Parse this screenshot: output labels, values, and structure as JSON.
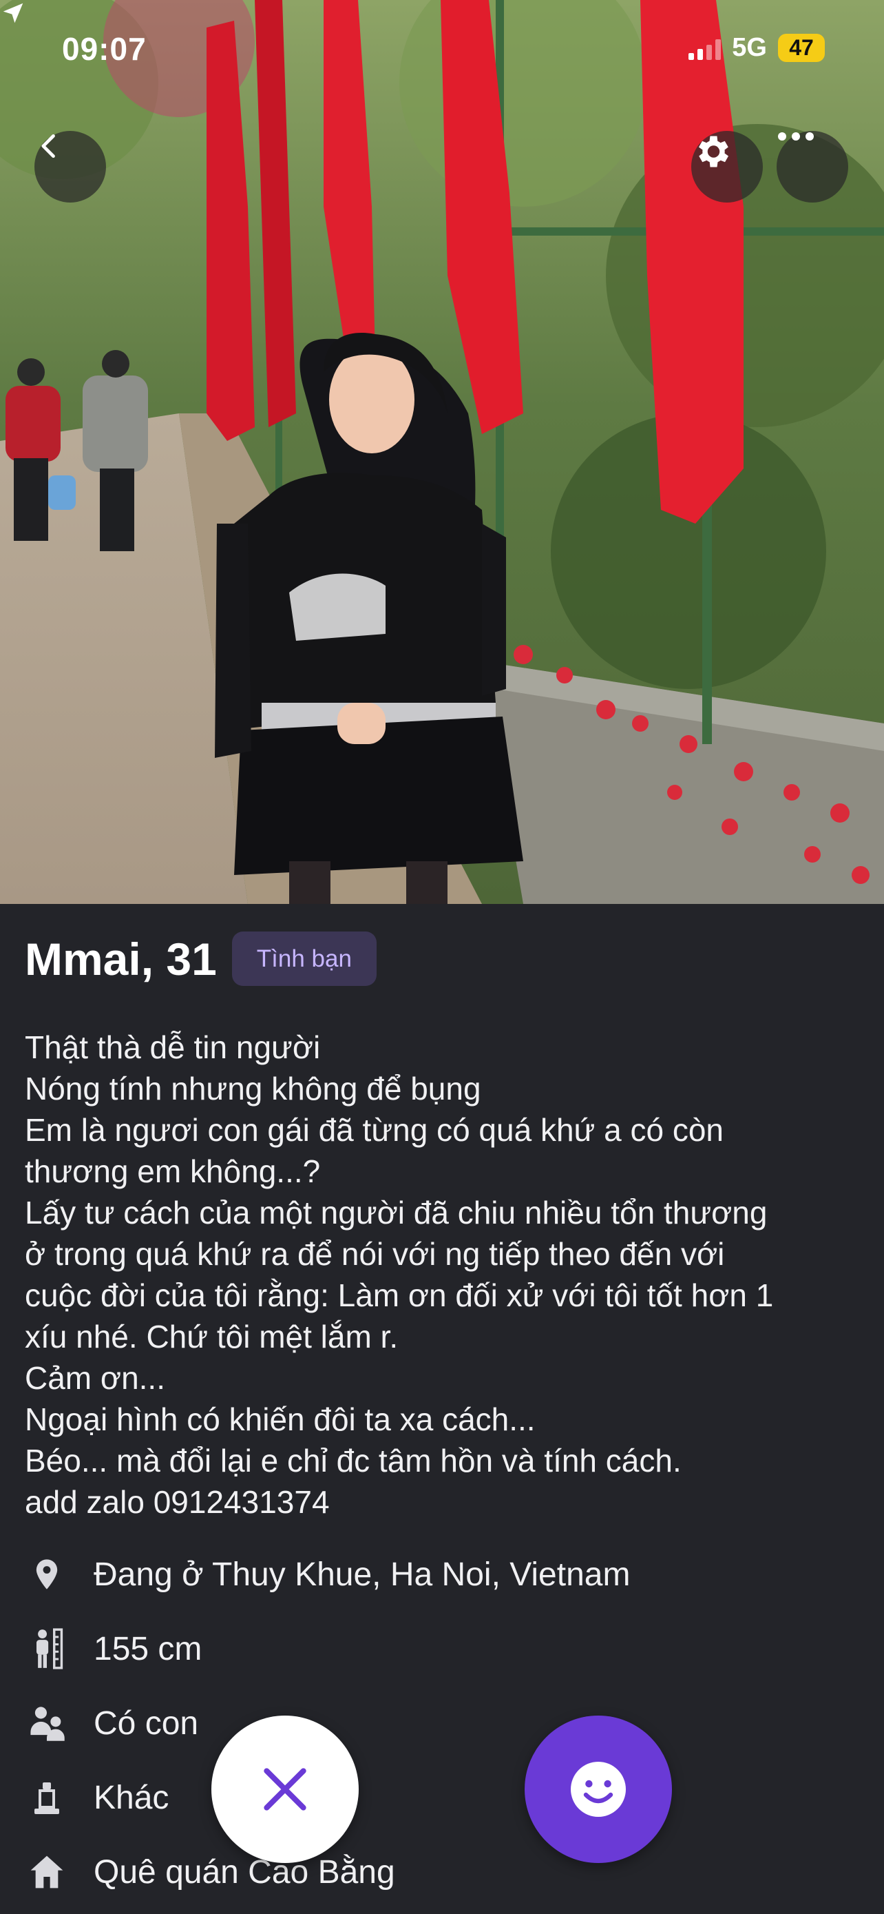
{
  "status_bar": {
    "time": "09:07",
    "network": "5G",
    "battery": "47"
  },
  "top_bar": {
    "back_icon": "chevron-left-icon",
    "settings_icon": "gear-icon",
    "more_icon": "more-horizontal-icon"
  },
  "profile": {
    "name_age": "Mmai, 31",
    "tag": "Tình bạn",
    "bio_lines": [
      "Thật thà dễ tin người",
      "Nóng tính nhưng không để bụng",
      "Em là ngươi con gái đã từng có quá khứ a có còn",
      "thương em không...?",
      "Lấy tư cách của một người đã chiu nhiều tổn thương",
      "ở trong quá khứ ra để nói với ng tiếp theo đến với",
      "cuộc đời của tôi rằng: Làm ơn đối xử với tôi tốt hơn 1",
      "xíu nhé. Chứ tôi mệt lắm r.",
      "Cảm ơn...",
      "Ngoại hình có khiến đôi ta xa cách...",
      "Béo... mà đổi lại e chỉ đc tâm hồn và tính cách.",
      "add zalo 0912431374"
    ],
    "details": [
      {
        "icon": "location-pin-icon",
        "text": "Đang ở Thuy Khue, Ha Noi, Vietnam"
      },
      {
        "icon": "height-icon",
        "text": "155 cm"
      },
      {
        "icon": "children-icon",
        "text": "Có con"
      },
      {
        "icon": "religion-icon",
        "text": "Khác"
      },
      {
        "icon": "home-icon",
        "text": "Quê quán Cao Bằng"
      }
    ]
  },
  "actions": {
    "pass_icon": "close-icon",
    "like_icon": "smiley-icon"
  },
  "colors": {
    "background": "#232429",
    "accent": "#6a3ad6",
    "tag_bg": "#3c3655",
    "tag_text": "#c7b6ff"
  }
}
